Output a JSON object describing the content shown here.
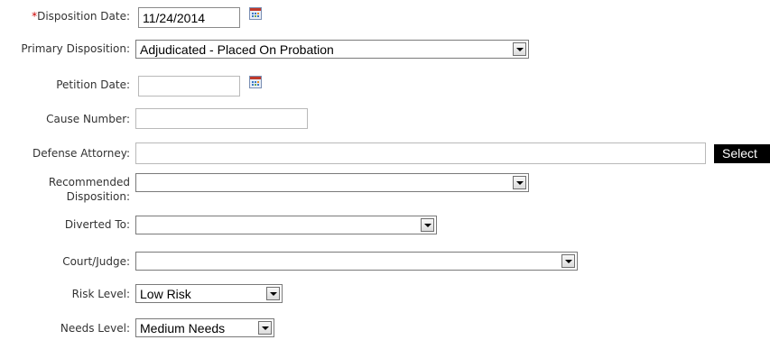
{
  "form": {
    "disposition_date": {
      "label": "Disposition Date:",
      "required_mark": "*",
      "value": "11/24/2014"
    },
    "primary_disposition": {
      "label": "Primary Disposition:",
      "value": "Adjudicated - Placed On Probation"
    },
    "petition_date": {
      "label": "Petition Date:",
      "value": ""
    },
    "cause_number": {
      "label": "Cause Number:",
      "value": ""
    },
    "defense_attorney": {
      "label": "Defense Attorney:",
      "value": "",
      "select_button": "Select"
    },
    "recommended_disposition": {
      "label_line1": "Recommended",
      "label_line2": "Disposition:",
      "value": ""
    },
    "diverted_to": {
      "label": "Diverted To:",
      "value": ""
    },
    "court_judge": {
      "label": "Court/Judge:",
      "value": ""
    },
    "risk_level": {
      "label": "Risk Level:",
      "value": "Low Risk"
    },
    "needs_level": {
      "label": "Needs Level:",
      "value": "Medium Needs"
    }
  },
  "icons": {
    "calendar": "calendar-icon",
    "dropdown": "chevron-down-icon"
  },
  "colors": {
    "required": "#cc0000",
    "select_button_bg": "#000000",
    "select_button_text": "#ffffff"
  }
}
